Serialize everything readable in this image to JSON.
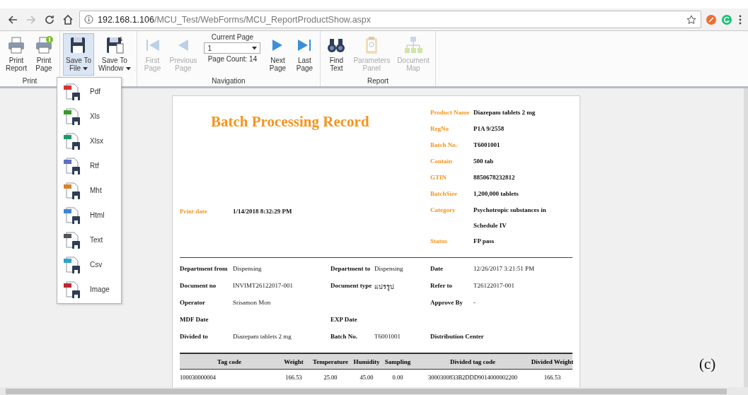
{
  "browser": {
    "url_host": "192.168.1.106",
    "url_path": "/MCU_Test/WebForms/MCU_ReportProductShow.aspx"
  },
  "ribbon": [
    {
      "label": "Print",
      "tools": [
        {
          "kind": "button",
          "text": "Print\nReport",
          "selected": false,
          "disabled": false,
          "has_menu": false
        },
        {
          "kind": "button",
          "text": "Print\nPage",
          "selected": false,
          "disabled": false,
          "has_menu": false
        }
      ]
    },
    {
      "tools": [
        {
          "kind": "button",
          "text": "Save To\nFile",
          "selected": true,
          "disabled": false,
          "has_menu": true
        },
        {
          "kind": "button",
          "text": "Save To\nWindow",
          "selected": false,
          "disabled": false,
          "has_menu": true
        }
      ]
    },
    {
      "label": "Navigation",
      "tools": [
        {
          "kind": "button",
          "text": "First\nPage",
          "selected": false,
          "disabled": true,
          "has_menu": false
        },
        {
          "kind": "button",
          "text": "Previous\nPage",
          "selected": false,
          "disabled": true,
          "has_menu": false
        },
        {
          "kind": "pager",
          "caption": "Current Page",
          "value": "1",
          "count": "Page Count: 14"
        },
        {
          "kind": "button",
          "text": "Next\nPage",
          "selected": false,
          "disabled": false,
          "has_menu": false
        },
        {
          "kind": "button",
          "text": "Last\nPage",
          "selected": false,
          "disabled": false,
          "has_menu": false
        }
      ]
    },
    {
      "label": "Report",
      "tools": [
        {
          "kind": "button",
          "text": "Find\nText",
          "selected": false,
          "disabled": false,
          "has_menu": false
        },
        {
          "kind": "button",
          "text": "Parameters\nPanel",
          "selected": false,
          "disabled": true,
          "has_menu": false
        },
        {
          "kind": "button",
          "text": "Document\nMap",
          "selected": false,
          "disabled": true,
          "has_menu": false
        }
      ]
    }
  ],
  "save_menu": [
    {
      "label": "Pdf",
      "color": "#d9322e"
    },
    {
      "label": "Xls",
      "color": "#3a9a2a"
    },
    {
      "label": "Xlsx",
      "color": "#1f9a6a"
    },
    {
      "label": "Rtf",
      "color": "#5b6fc8"
    },
    {
      "label": "Mht",
      "color": "#d9822b"
    },
    {
      "label": "Html",
      "color": "#3d86d6"
    },
    {
      "label": "Text",
      "color": "#555555"
    },
    {
      "label": "Csv",
      "color": "#2fa3c7"
    },
    {
      "label": "Image",
      "color": "#b8282e"
    }
  ],
  "report": {
    "title": "Batch Processing Record",
    "print_date": {
      "label": "Print date",
      "value": "1/14/2018 8:32:29 PM"
    },
    "product_info": [
      {
        "label": "Product Name",
        "value": "Diazepam tablets 2 mg"
      },
      {
        "label": "RegNo",
        "value": "P1A 9/2558"
      },
      {
        "label": "Batch No.",
        "value": "T6001001"
      },
      {
        "label": "Contain",
        "value": "500 tab"
      },
      {
        "label": "GTIN",
        "value": "8850678232812"
      },
      {
        "label": "BatchSize",
        "value": "1,200,000 tablets"
      },
      {
        "label": "Category",
        "value": "Psychotropic substances in Schedule IV"
      },
      {
        "label": "Status",
        "value": "FP pass"
      }
    ],
    "details": [
      {
        "left": {
          "label": "Department from",
          "value": "Dispensing"
        },
        "middle": {
          "label": "Department to",
          "value": "Dispensing"
        },
        "right": {
          "label": "Date",
          "value": "12/26/2017 3:21:51 PM"
        }
      },
      {
        "left": {
          "label": "Document no",
          "value": "INVIMT26122017-001"
        },
        "middle": {
          "label": "Document type",
          "value": "แปรรูป"
        },
        "right": {
          "label": "Refer to",
          "value": "T26122017-001"
        }
      },
      {
        "left": {
          "label": "Operator",
          "value": "Srisamon Mon"
        },
        "right": {
          "label": "Approve By",
          "value": "-"
        }
      },
      {
        "left": {
          "label": "MDF Date"
        },
        "middle": {
          "label": "EXP Date"
        }
      },
      {
        "left": {
          "label": "Divided to",
          "value": "Diazepam tablets 2 mg"
        },
        "middle": {
          "label": "Batch No.",
          "value": "T6001001"
        },
        "right": {
          "label": "Distribution Center"
        }
      }
    ],
    "table": {
      "columns": [
        "Tag code",
        "Weight",
        "Temperature",
        "Humidity",
        "Sampling",
        "Divided tag code",
        "Divided Weight"
      ],
      "rows": [
        [
          "100030000004",
          "166.53",
          "25.00",
          "45.00",
          "0.00",
          "3000300833B2DDD9014000002200",
          "166.53"
        ]
      ]
    }
  },
  "figure_label": "(c)"
}
